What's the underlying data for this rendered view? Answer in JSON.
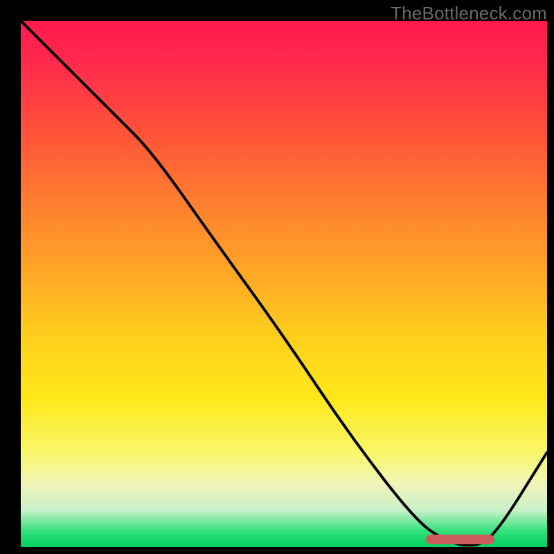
{
  "watermark": "TheBottleneck.com",
  "chart_data": {
    "type": "line",
    "title": "",
    "xlabel": "",
    "ylabel": "",
    "xlim": [
      0,
      100
    ],
    "ylim": [
      0,
      100
    ],
    "x": [
      0,
      5,
      18,
      25,
      37,
      50,
      62,
      75,
      81,
      86,
      90,
      100
    ],
    "values": [
      100,
      95,
      82,
      75,
      58,
      40,
      22,
      5,
      1,
      0,
      2,
      18
    ],
    "optimal_range_x": [
      77,
      90
    ],
    "gradient_stops": [
      {
        "pos": 0,
        "color": "#ff1a4d"
      },
      {
        "pos": 50,
        "color": "#ffa726"
      },
      {
        "pos": 80,
        "color": "#fff06a"
      },
      {
        "pos": 100,
        "color": "#00d060"
      }
    ]
  }
}
